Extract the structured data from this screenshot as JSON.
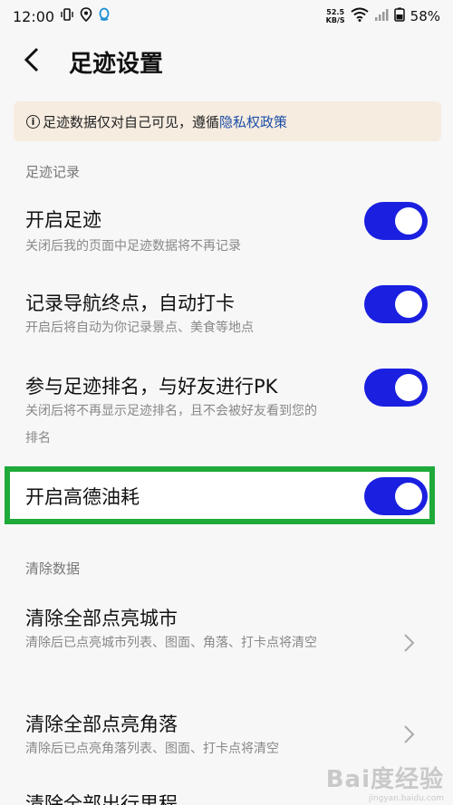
{
  "status_bar": {
    "time": "12:00",
    "net_speed_value": "52.5",
    "net_speed_unit": "KB/S",
    "battery": "58%",
    "icons": [
      "vibrate-icon",
      "location-icon",
      "qq-icon",
      "wifi-icon",
      "signal-icon",
      "battery-icon"
    ]
  },
  "header": {
    "title": "足迹设置",
    "back_icon": "chevron-left-icon"
  },
  "notice": {
    "text": "足迹数据仅对自己可见，遵循 ",
    "link": "隐私权政策",
    "icon": "info-icon"
  },
  "sections": {
    "records": "足迹记录",
    "clear": "清除数据"
  },
  "settings": [
    {
      "title": "开启足迹",
      "desc": "关闭后我的页面中足迹数据将不再记录",
      "enabled": true
    },
    {
      "title": "记录导航终点，自动打卡",
      "desc": "开启后将自动为你记录景点、美食等地点",
      "enabled": true
    },
    {
      "title": "参与足迹排名，与好友进行PK",
      "desc": "关闭后将不再显示足迹排名，且不会被好友看到您的排名",
      "enabled": true
    },
    {
      "title": "开启高德油耗",
      "enabled": true
    }
  ],
  "clear_items": [
    {
      "title": "清除全部点亮城市",
      "desc": "清除后已点亮城市列表、图面、角落、打卡点将清空"
    },
    {
      "title": "清除全部点亮角落",
      "desc": "清除后已点亮角落列表、图面、打卡点将清空"
    },
    {
      "title": "清除全部出行里程"
    }
  ],
  "colors": {
    "toggle_on": "#1a1fe0",
    "highlight_border": "#1faa3a",
    "notice_bg": "#f6ece0",
    "link": "#1e4fa8"
  },
  "watermark": {
    "main": "Bai度经验",
    "sub": "jingyan.baidu.com"
  }
}
